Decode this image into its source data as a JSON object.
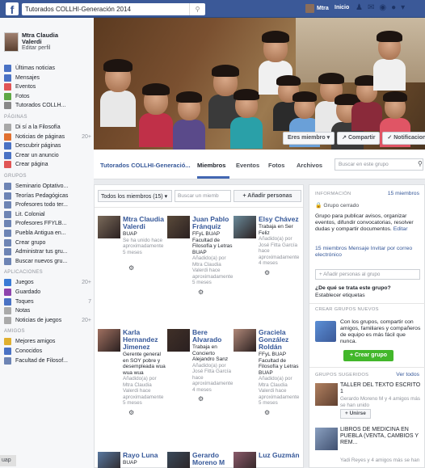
{
  "topbar": {
    "logo": "f",
    "search_value": "Tutorados COLLHI-Generación 2014",
    "user_name": "Mtra",
    "home_label": "Inicio"
  },
  "leftnav": {
    "user": {
      "name_line1": "Mtra Claudia",
      "name_line2": "Valerdi",
      "edit": "Editar perfil"
    },
    "main_items": [
      {
        "label": "Últimas noticias",
        "icon": "news-icon",
        "color": "#4a72c4"
      },
      {
        "label": "Mensajes",
        "icon": "messages-icon",
        "color": "#4a72c4"
      },
      {
        "label": "Eventos",
        "icon": "events-icon",
        "color": "#e05555"
      },
      {
        "label": "Fotos",
        "icon": "photos-icon",
        "color": "#5fa845"
      },
      {
        "label": "Tutorados COLLH...",
        "icon": "group-icon",
        "color": "#888888"
      }
    ],
    "pages_header": "PÁGINAS",
    "pages_items": [
      {
        "label": "Di sí a la Filosofía",
        "count": ""
      },
      {
        "label": "Noticias de páginas",
        "count": "20+"
      },
      {
        "label": "Descubrir páginas",
        "count": ""
      },
      {
        "label": "Crear un anuncio",
        "count": ""
      },
      {
        "label": "Crear página",
        "count": ""
      }
    ],
    "groups_header": "GRUPOS",
    "groups_items": [
      {
        "label": "Seminario Optativo..."
      },
      {
        "label": "Teorías Pedagógicas"
      },
      {
        "label": "Profesores todo ter..."
      },
      {
        "label": "Lit. Colonial"
      },
      {
        "label": "Profesores FFYLB..."
      },
      {
        "label": "Puebla Antigua en..."
      },
      {
        "label": "Crear grupo"
      },
      {
        "label": "Administrar tus gru..."
      },
      {
        "label": "Buscar nuevos gru..."
      }
    ],
    "apps_header": "APLICACIONES",
    "apps_items": [
      {
        "label": "Juegos",
        "count": "20+"
      },
      {
        "label": "Guardado",
        "count": ""
      },
      {
        "label": "Toques",
        "count": "7"
      },
      {
        "label": "Notas",
        "count": ""
      },
      {
        "label": "Noticias de juegos",
        "count": "20+"
      }
    ],
    "friends_header": "AMIGOS",
    "friends_items": [
      {
        "label": "Mejores amigos"
      },
      {
        "label": "Conocidos"
      },
      {
        "label": "Facultad de Filosof..."
      }
    ],
    "corner_tag": "uap"
  },
  "cover": {
    "member_btn": "Eres miembro ▾",
    "share_btn": "↗ Compartir",
    "notif_btn": "✓ Notificaciones",
    "more_btn": "•••"
  },
  "tabs": {
    "group_name": "Tutorados COLLHI-Generació...",
    "members": "Miembros",
    "events": "Eventos",
    "photos": "Fotos",
    "files": "Archivos",
    "search_placeholder": "Buscar en este grupo"
  },
  "members_panel": {
    "filter": "Todos los miembros (15) ▾",
    "search_placeholder": "Buscar un miemb",
    "add_people": "+ Añadir personas",
    "cards": [
      {
        "name": "Mtra Claudia Valerdi",
        "sub": "BUAP",
        "meta": "Se ha unido hace aproximadamente 5 meses"
      },
      {
        "name": "Juan Pablo Fránquiz",
        "sub": "FFyL BUAP Facultad de Filosofía y Letras BUAP",
        "meta": "Añadido(a) por Mtra Claudia Valerdi hace aproximadamente 5 meses"
      },
      {
        "name": "Elsy Chávez",
        "sub": "Trabaja en Ser Feliz",
        "meta": "Añadido(a) por José Fitta García hace aproximadamente 4 meses"
      },
      {
        "name": "Karla Hernandez Jimenez",
        "sub": "Gerente general en SOY pobre y desempleada wua wua wua",
        "meta": "Añadido(a) por Mtra Claudia Valerdi hace aproximadamente 5 meses"
      },
      {
        "name": "Bere Alvarado",
        "sub": "Trabaja en Concierto Alejandro Sanz",
        "meta": "Añadido(a) por José Fitta García hace aproximadamente 4 meses"
      },
      {
        "name": "Graciela González Roldán",
        "sub": "FFyL BUAP Facultad de Filosofía y Letras BUAP",
        "meta": "Añadido(a) por Mtra Claudia Valerdi hace aproximadamente 5 meses"
      },
      {
        "name": "Rayo Luna",
        "sub": "BUAP",
        "meta": ""
      },
      {
        "name": "Gerardo Moreno M",
        "sub": "",
        "meta": ""
      },
      {
        "name": "Luz Guzmán",
        "sub": "",
        "meta": ""
      }
    ]
  },
  "info_panel": {
    "header": "INFORMACIÓN",
    "members_count": "15 miembros",
    "group_type": "Grupo cerrado",
    "description": "Grupo para publicar avisos, organizar eventos, difundir convocatorias, resolver dudas y compartir documentos.",
    "edit": "Editar",
    "members_link": "15 miembros",
    "message_link": "Mensaje",
    "invite_link": "Invitar por correo electrónico",
    "add_people_placeholder": "+ Añadir personas al grupo",
    "question": "¿De qué se trata este grupo?",
    "tags_link": "Establecer etiquetas",
    "create_header": "CREAR GRUPOS NUEVOS",
    "create_text": "Con los grupos, compartir con amigos, familiares y compañeros de equipo es más fácil que nunca.",
    "create_btn": "+ Crear grupo",
    "suggested_header": "GRUPOS SUGERIDOS",
    "see_all": "Ver todos",
    "suggested": [
      {
        "title": "TALLER DEL TEXTO ESCRITO 1",
        "meta": "Gerardo Moreno M y 4 amigos más se han unido",
        "join": "+ Unirse"
      },
      {
        "title": "LIBROS DE MEDICINA EN PUEBLA (VENTA, CAMBIOS Y REM...",
        "meta": "Yadi Reyes y 4 amigos más se han"
      }
    ]
  }
}
